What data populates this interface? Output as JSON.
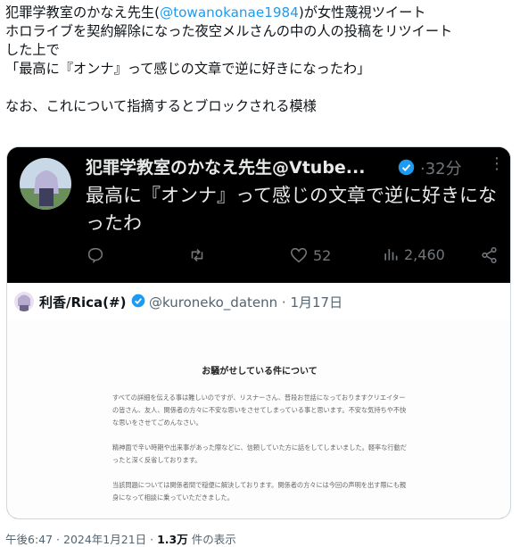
{
  "post": {
    "line1_a": "犯罪学教室のかなえ先生(",
    "line1_mention": "@towanokanae1984",
    "line1_b": ")が女性蔑視ツイート",
    "line2": "ホロライブを契約解除になった夜空メルさんの中の人の投稿をリツイート",
    "line3": "した上で",
    "line4": "「最高に『オンナ』って感じの文章で逆に好きになったわ」",
    "line6": "なお、これについて指摘するとブロックされる模様"
  },
  "quoted_dark": {
    "name": "犯罪学教室のかなえ先生@Vtube...",
    "time": "·32分",
    "more": "⋮",
    "body": "最高に『オンナ』って感じの文章で逆に好きになったわ",
    "likes": "52",
    "views": "2,460",
    "icons": [
      "reply-icon",
      "retweet-icon",
      "heart-icon",
      "views-icon",
      "share-icon",
      "verified-icon"
    ]
  },
  "quoted_light": {
    "name": "利香/Rica(#)",
    "handle": "@kuroneko_datenn · 1月17日"
  },
  "notice": {
    "title": "お騒がせしている件について",
    "p1": "すべての詳細を伝える事は難しいのですが、リスナーさん、普段お世話になっておりますクリエイターの皆さん、友人、関係者の方々に不安な思いをさせてしまっている事と思います。不安な気持ちや不快な思いをさせてごめんなさい。",
    "p2": "精神面で辛い時期や出来事があった際などに、信頼していた方に話をしてしまいました。軽率な行動だったと深く反省しております。",
    "p3": "当該問題については関係者間で穏便に解決しております。関係者の方々には今回の声明を出す際にも親身になって相談に乗っていただきました。"
  },
  "meta": {
    "datetime": "午後6:47 · 2024年1月21日 · ",
    "views_count": "1.3万",
    "views_label": " 件の表示"
  },
  "colors": {
    "link": "#1d9bf0",
    "dark_bg": "#000000",
    "muted": "#71767b",
    "verified": "#1d9bf0"
  }
}
